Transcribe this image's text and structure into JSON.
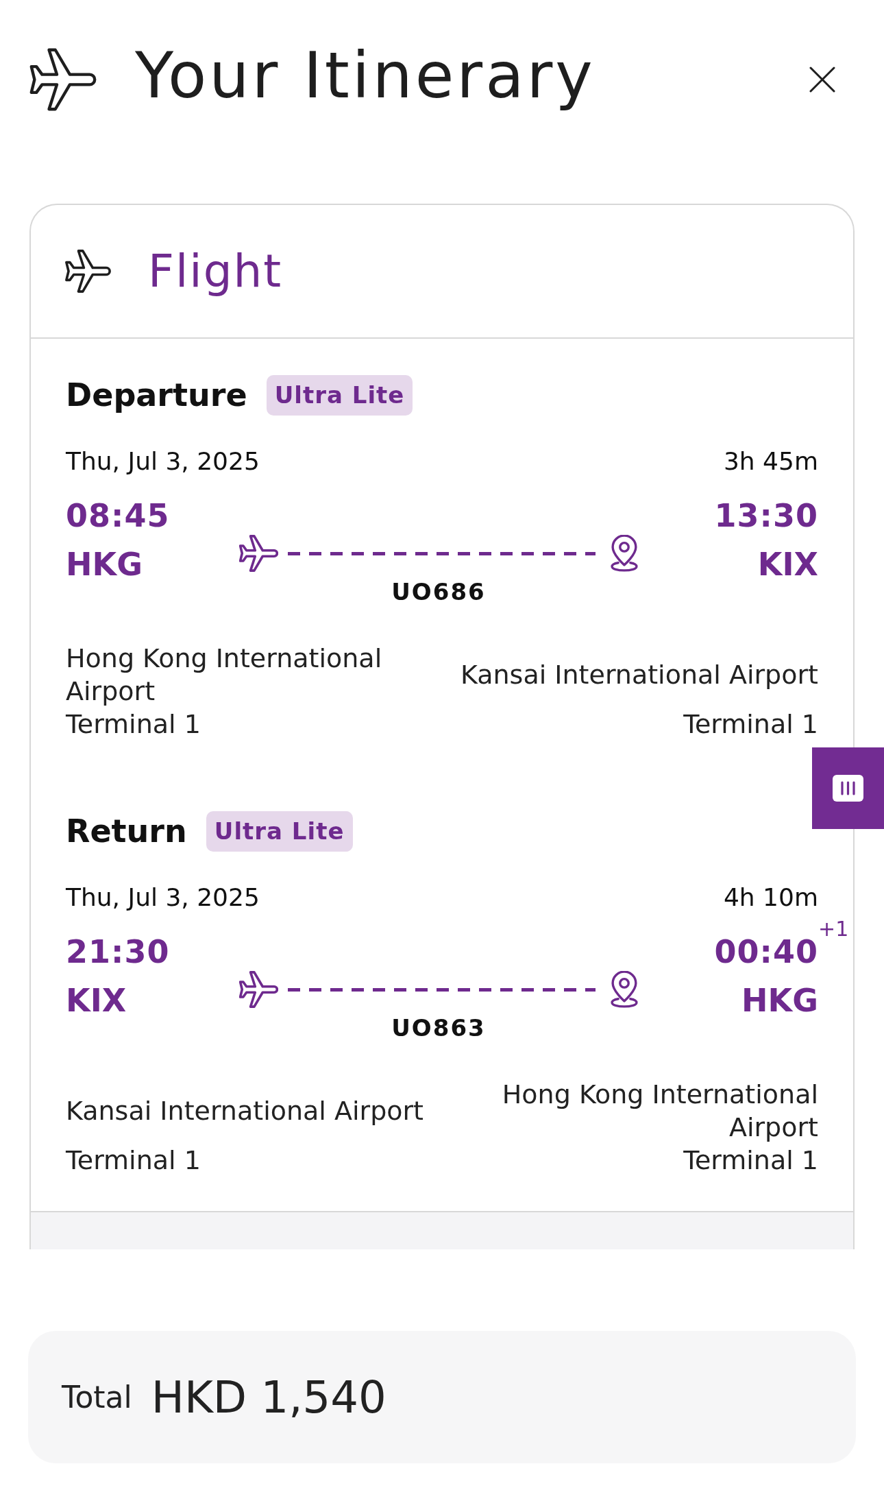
{
  "header": {
    "title": "Your Itinerary"
  },
  "card": {
    "title": "Flight",
    "segments": [
      {
        "label": "Departure",
        "fare": "Ultra Lite",
        "date": "Thu, Jul 3, 2025",
        "duration": "3h 45m",
        "flight_number": "UO686",
        "origin": {
          "time": "08:45",
          "code": "HKG",
          "airport": "Hong Kong International Airport",
          "terminal": "Terminal 1"
        },
        "destination": {
          "time": "13:30",
          "code": "KIX",
          "airport": "Kansai International Airport",
          "terminal": "Terminal 1"
        }
      },
      {
        "label": "Return",
        "fare": "Ultra Lite",
        "date": "Thu, Jul 3, 2025",
        "duration": "4h 10m",
        "flight_number": "UO863",
        "origin": {
          "time": "21:30",
          "code": "KIX",
          "airport": "Kansai International Airport",
          "terminal": "Terminal 1"
        },
        "destination": {
          "time": "00:40",
          "day_offset": "+1",
          "code": "HKG",
          "airport": "Hong Kong International Airport",
          "terminal": "Terminal 1"
        }
      }
    ]
  },
  "total": {
    "label": "Total",
    "amount": "HKD 1,540"
  }
}
